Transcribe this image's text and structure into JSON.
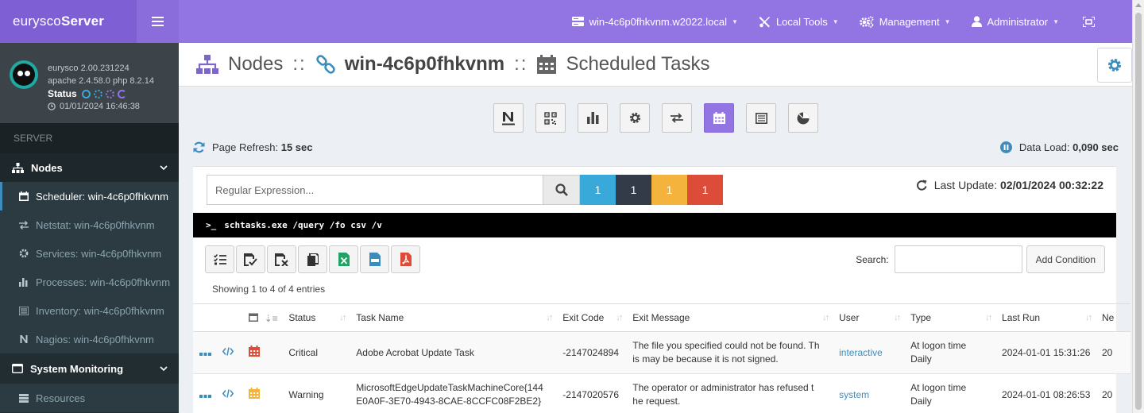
{
  "app": {
    "brand_light": "eurysco",
    "brand_bold": "Server"
  },
  "topnav": {
    "host": "win-4c6p0fhkvnm.w2022.local",
    "local_tools": "Local Tools",
    "management": "Management",
    "user": "Administrator"
  },
  "sidebar": {
    "version": "eurysco 2.00.231224",
    "stack": "apache 2.4.58.0  php 8.2.14",
    "status_label": "Status",
    "timestamp": "01/01/2024 16:46:38",
    "section": "SERVER",
    "nodes_label": "Nodes",
    "items": [
      {
        "label": "Scheduler:",
        "host": "win-4c6p0fhkvnm",
        "icon": "calendar-icon"
      },
      {
        "label": "Netstat:",
        "host": "win-4c6p0fhkvnm",
        "icon": "exchange-icon"
      },
      {
        "label": "Services:",
        "host": "win-4c6p0fhkvnm",
        "icon": "gear-icon"
      },
      {
        "label": "Processes:",
        "host": "win-4c6p0fhkvnm",
        "icon": "bar-chart-icon"
      },
      {
        "label": "Inventory:",
        "host": "win-4c6p0fhkvnm",
        "icon": "list-icon"
      },
      {
        "label": "Nagios:",
        "host": "win-4c6p0fhkvnm",
        "icon": "nagios-icon"
      }
    ],
    "system_monitoring": "System Monitoring",
    "resources": "Resources"
  },
  "page": {
    "nodes": "Nodes",
    "sep": "::",
    "host": "win-4c6p0fhkvnm",
    "section": "Scheduled Tasks"
  },
  "toolbar": {
    "refresh_label": "Page Refresh:",
    "refresh_value": "15 sec",
    "load_label": "Data Load:",
    "load_value": "0,090 sec"
  },
  "filter": {
    "placeholder": "Regular Expression...",
    "counts": [
      {
        "value": "1",
        "color": "#38a9d9"
      },
      {
        "value": "1",
        "color": "#333a48"
      },
      {
        "value": "1",
        "color": "#f3b33d"
      },
      {
        "value": "1",
        "color": "#dd4b39"
      }
    ],
    "last_update_label": "Last Update:",
    "last_update_value": "02/01/2024 00:32:22"
  },
  "console": {
    "command": "schtasks.exe /query /fo csv /v"
  },
  "table": {
    "search_label": "Search:",
    "add_condition": "Add Condition",
    "info": "Showing 1 to 4 of 4 entries",
    "columns": [
      "Status",
      "Task Name",
      "Exit Code",
      "Exit Message",
      "User",
      "Type",
      "Last Run",
      "Ne"
    ],
    "rows": [
      {
        "status": "Critical",
        "status_color": "#dd4b39",
        "task_name": "Adobe Acrobat Update Task",
        "task_name_2": "",
        "exit_code": "-2147024894",
        "exit_message": "The file you specified could not be found. Th",
        "exit_message_2": "is may be because it is not signed.",
        "user": "interactive",
        "type": "At logon time",
        "type_2": "Daily",
        "last_run": "2024-01-01 15:31:26",
        "next": "20"
      },
      {
        "status": "Warning",
        "status_color": "#f3b33d",
        "task_name": "MicrosoftEdgeUpdateTaskMachineCore{144",
        "task_name_2": "E0A0F-3E70-4943-8CAE-8CCFC08F2BE2}",
        "exit_code": "-2147020576",
        "exit_message": "The operator or administrator has refused t",
        "exit_message_2": "he request.",
        "user": "system",
        "type": "At logon time",
        "type_2": "Daily",
        "last_run": "2024-01-01 08:26:53",
        "next": "20"
      }
    ]
  },
  "colors": {
    "accent": "#9275e2",
    "sidebar": "#222d32",
    "link": "#3c8dbc"
  }
}
